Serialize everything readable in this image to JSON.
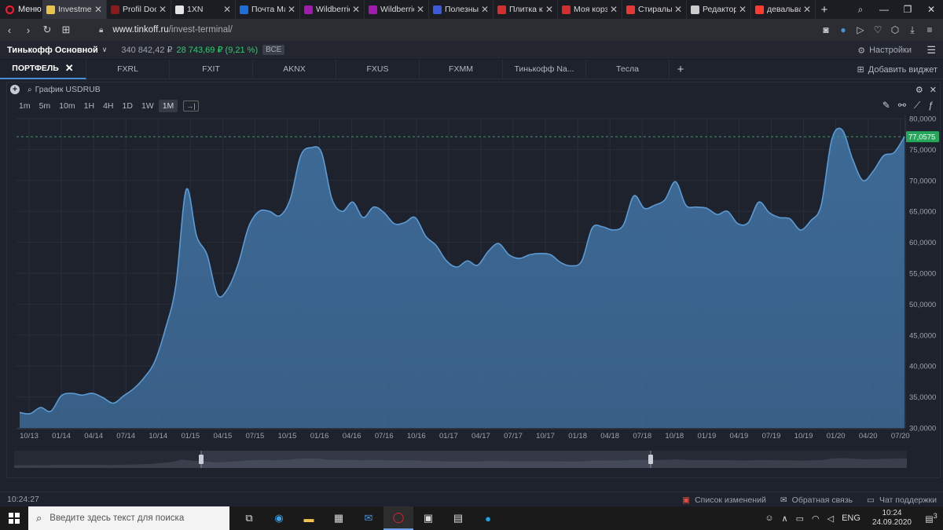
{
  "browser": {
    "menu_label": "Меню",
    "tabs": [
      {
        "title": "Investmen",
        "color": "#e8c24a",
        "active": true
      },
      {
        "title": "Profil Doc",
        "color": "#8b1a1a",
        "active": false
      },
      {
        "title": "1XN",
        "color": "#e6e6e6",
        "active": false
      },
      {
        "title": "Почта Ма",
        "color": "#1e6fd9",
        "active": false
      },
      {
        "title": "Wildberrie",
        "color": "#a21bb0",
        "active": false
      },
      {
        "title": "Wildberrie",
        "color": "#a21bb0",
        "active": false
      },
      {
        "title": "Полезные",
        "color": "#3b5bdb",
        "active": false
      },
      {
        "title": "Плитка кс",
        "color": "#d32f2f",
        "active": false
      },
      {
        "title": "Моя корз",
        "color": "#d32f2f",
        "active": false
      },
      {
        "title": "Стиральн",
        "color": "#e53935",
        "active": false
      },
      {
        "title": "Редактор",
        "color": "#cccccc",
        "active": false
      },
      {
        "title": "девальва",
        "color": "#ff3b30",
        "active": false
      }
    ],
    "url_host": "www.tinkoff.ru",
    "url_path": "/invest-terminal/"
  },
  "account": {
    "name": "Тинькофф Основной",
    "balance": "340 842,42 ₽",
    "profit": "28 743,69 ₽ (9,21 %)",
    "badge": "ВСЕ",
    "settings_label": "Настройки"
  },
  "widget_tabs": [
    {
      "label": "ПОРТФЕЛЬ",
      "active": true
    },
    {
      "label": "FXRL",
      "active": false
    },
    {
      "label": "FXIT",
      "active": false
    },
    {
      "label": "AKNX",
      "active": false
    },
    {
      "label": "FXUS",
      "active": false
    },
    {
      "label": "FXMM",
      "active": false
    },
    {
      "label": "Тинькофф Na...",
      "active": false
    },
    {
      "label": "Тесла",
      "active": false
    }
  ],
  "add_widget_label": "Добавить виджет",
  "chart_widget": {
    "title": "График USDRUB",
    "intervals": [
      "1m",
      "5m",
      "10m",
      "1H",
      "4H",
      "1D",
      "1W",
      "1M"
    ],
    "selected_interval": "1M"
  },
  "chart_data": {
    "type": "area",
    "title": "",
    "xlabel": "",
    "ylabel": "",
    "x_tick_labels": [
      "10/13",
      "01/14",
      "04/14",
      "07/14",
      "10/14",
      "01/15",
      "04/15",
      "07/15",
      "10/15",
      "01/16",
      "04/16",
      "07/16",
      "10/16",
      "01/17",
      "04/17",
      "07/17",
      "10/17",
      "01/18",
      "04/18",
      "07/18",
      "10/18",
      "01/19",
      "04/19",
      "07/19",
      "10/19",
      "01/20",
      "04/20",
      "07/20"
    ],
    "y_tick_labels": [
      "80,0000",
      "75,0000",
      "70,0000",
      "65,0000",
      "60,0000",
      "55,0000",
      "50,0000",
      "45,0000",
      "40,0000",
      "35,0000",
      "30,0000"
    ],
    "ylim": [
      30,
      80
    ],
    "last_price": 77.0575,
    "last_price_label": "77,0575",
    "line_color": "#5b9bd5",
    "fill_color": "#3d6a96",
    "price_tag_color": "#26a65b",
    "series": [
      {
        "values": [
          32.5,
          32.3,
          33.3,
          32.7,
          35.2,
          35.6,
          35.3,
          35.6,
          34.9,
          34.0,
          35.2,
          36.4,
          38.2,
          40.8,
          46.0,
          53.0,
          68.5,
          61.0,
          58.0,
          51.5,
          52.5,
          56.5,
          62.5,
          65.0,
          65.0,
          64.3,
          67.0,
          74.0,
          75.3,
          74.5,
          67.0,
          65.0,
          66.5,
          64.0,
          65.7,
          64.8,
          63.0,
          63.2,
          64.0,
          61.0,
          59.5,
          57.0,
          56.0,
          57.0,
          56.3,
          58.5,
          59.8,
          58.0,
          57.4,
          58.0,
          58.2,
          58.0,
          56.7,
          56.2,
          57.0,
          62.3,
          62.5,
          62.0,
          62.8,
          67.5,
          65.5,
          66.0,
          66.9,
          69.8,
          66.0,
          65.7,
          65.5,
          64.5,
          65.0,
          63.0,
          63.2,
          66.5,
          64.8,
          64.0,
          63.8,
          62.0,
          63.5,
          66.0,
          76.5,
          78.2,
          73.5,
          70.0,
          71.5,
          74.0,
          74.5,
          77.0575
        ]
      }
    ]
  },
  "status": {
    "time": "10:24:27",
    "changelog": "Список изменений",
    "feedback": "Обратная связь",
    "support": "Чат поддержки"
  },
  "taskbar": {
    "search_placeholder": "Введите здесь текст для поиска",
    "lang": "ENG",
    "time": "10:24",
    "date": "24.09.2020",
    "notifications": "3"
  }
}
